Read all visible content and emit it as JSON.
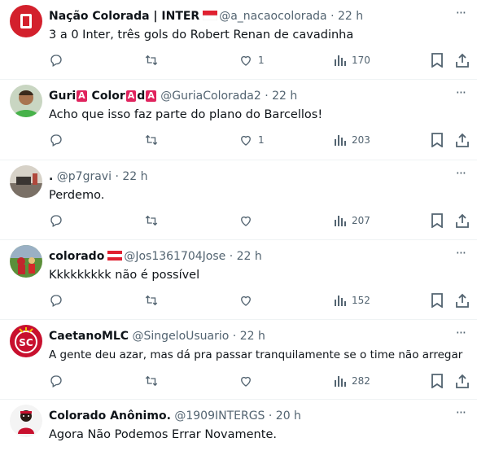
{
  "tweets": [
    {
      "name": "Nação Colorada | INTER",
      "handle": "@a_nacaocolorada",
      "time": "22 h",
      "text": "3 a 0 Inter, três gols do Robert Renan de cavadinha",
      "likes": "1",
      "views": "170"
    },
    {
      "name_parts": [
        "Guri",
        "A",
        " Color",
        "A",
        "d",
        "A"
      ],
      "handle": "@GuriaColorada2",
      "time": "22 h",
      "text": "Acho que isso faz parte do plano do Barcellos!",
      "likes": "1",
      "views": "203"
    },
    {
      "name": ".",
      "handle": "@p7gravi",
      "time": "22 h",
      "text": "Perdemo.",
      "likes": "",
      "views": "207"
    },
    {
      "name": "colorado",
      "handle": "@Jos1361704Jose",
      "time": "22 h",
      "text": "Kkkkkkkkk não é possível",
      "likes": "",
      "views": "152"
    },
    {
      "name": "CaetanoMLC",
      "handle": "@SingeloUsuario",
      "time": "22 h",
      "text": "A gente deu azar, mas dá pra passar tranquilamente se o time não arregar",
      "likes": "",
      "views": "282"
    },
    {
      "name": "Colorado Anônimo.",
      "handle": "@1909INTERGS",
      "time": "20 h",
      "text": "Agora Não Podemos Errar Novamente.",
      "likes": "",
      "views": ""
    }
  ],
  "sep": "·",
  "more": "···",
  "colors": {
    "text": "#0f1419",
    "muted": "#536471",
    "divider": "#eff3f4",
    "inter_red": "#d3202c"
  }
}
